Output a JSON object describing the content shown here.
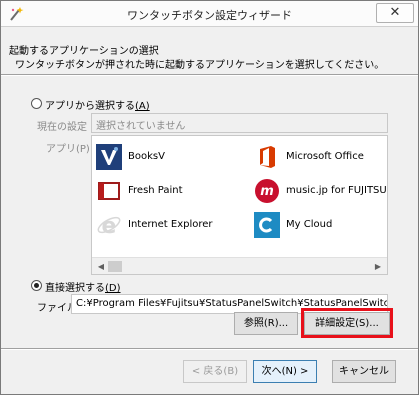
{
  "window": {
    "title": "ワンタッチボタン設定ウィザード",
    "close_glyph": "✕"
  },
  "header": {
    "title": "起動するアプリケーションの選択",
    "description": "ワンタッチボタンが押された時に起動するアプリケーションを選択してください。"
  },
  "option_app": {
    "label": "アプリから選択する",
    "accel": "(A)",
    "current_label": "現在の設定",
    "current_value": "選択されていません",
    "apps_label": "アプリ(P):",
    "apps": [
      {
        "name": "BooksV",
        "icon": "booksv-icon"
      },
      {
        "name": "Microsoft Office",
        "icon": "microsoft-office-icon"
      },
      {
        "name": "Fresh Paint",
        "icon": "fresh-paint-icon"
      },
      {
        "name": "music.jp for FUJITSU",
        "icon": "music-jp-icon"
      },
      {
        "name": "Internet Explorer",
        "icon": "internet-explorer-icon"
      },
      {
        "name": "My Cloud",
        "icon": "my-cloud-icon"
      }
    ],
    "scroll_left": "◀",
    "scroll_right": "▶"
  },
  "option_direct": {
    "label": "直接選択する",
    "accel": "(D)",
    "file_label": "ファイル",
    "file_value": "C:¥Program Files¥Fujitsu¥StatusPanelSwitch¥StatusPanelSwitch.exe",
    "browse_label": "参照(R)...",
    "detail_label": "詳細設定(S)..."
  },
  "footer": {
    "back_label": "< 戻る(B)",
    "next_label": "次へ(N) >",
    "cancel_label": "キャンセル"
  },
  "colors": {
    "highlight": "#e8101a",
    "office": "#d83b01",
    "music": "#c8102e",
    "cloud": "#1e8bc3",
    "booksv": "#1f3f7a"
  }
}
